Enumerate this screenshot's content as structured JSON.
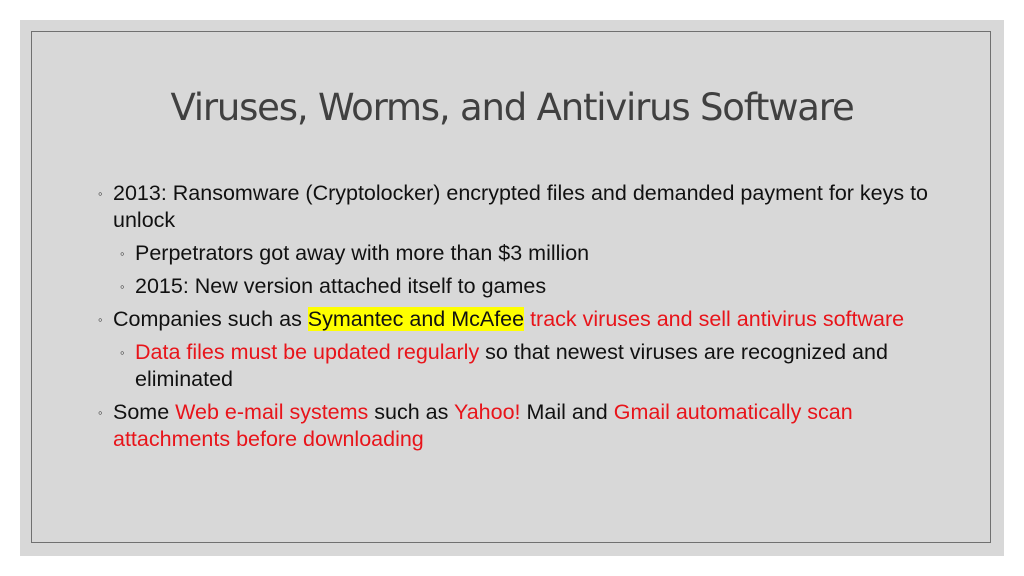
{
  "slide": {
    "title": "Viruses, Worms, and Antivirus Software",
    "bullet_glyph": "◦",
    "colors": {
      "background": "#d8d8d8",
      "text": "#111111",
      "emphasis": "#e8141a",
      "highlight": "#ffff00"
    },
    "items": [
      {
        "level": 1,
        "parts": [
          {
            "text": "2013: Ransomware (Cryptolocker) encrypted files and demanded payment for keys to unlock",
            "style": "normal"
          }
        ]
      },
      {
        "level": 2,
        "parts": [
          {
            "text": "Perpetrators got away with more than $3 million",
            "style": "normal"
          }
        ]
      },
      {
        "level": 2,
        "parts": [
          {
            "text": "2015: New version attached itself to games",
            "style": "normal"
          }
        ]
      },
      {
        "level": 1,
        "parts": [
          {
            "text": "Companies such as ",
            "style": "normal"
          },
          {
            "text": "Symantec and McAfee",
            "style": "highlight"
          },
          {
            "text": " track viruses and sell antivirus software",
            "style": "red"
          }
        ]
      },
      {
        "level": 2,
        "parts": [
          {
            "text": "Data files must be updated regularly",
            "style": "red"
          },
          {
            "text": " so that newest  viruses are recognized and eliminated",
            "style": "normal"
          }
        ]
      },
      {
        "level": 1,
        "parts": [
          {
            "text": "Some ",
            "style": "normal"
          },
          {
            "text": "Web e-mail systems",
            "style": "red"
          },
          {
            "text": " such as ",
            "style": "normal"
          },
          {
            "text": "Yahoo!",
            "style": "red"
          },
          {
            "text": " Mail and ",
            "style": "normal"
          },
          {
            "text": "Gmail automatically scan attachments before downloading",
            "style": "red"
          }
        ]
      }
    ]
  }
}
